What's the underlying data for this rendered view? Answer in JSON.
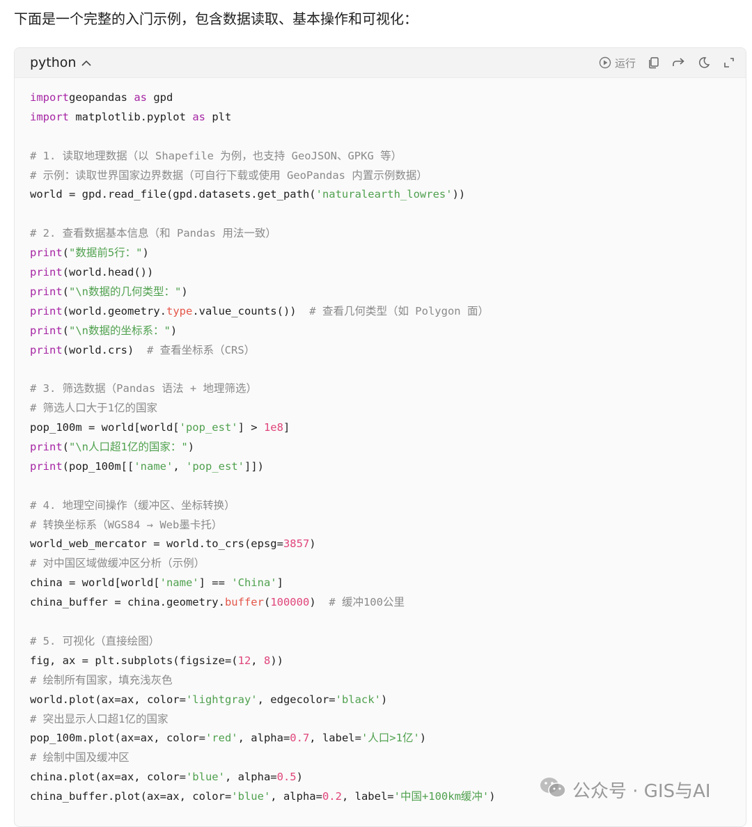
{
  "intro_text": "下面是一个完整的入门示例，包含数据读取、基本操作和可视化：",
  "code_block": {
    "language": "python",
    "run_label": "运行",
    "icons": {
      "collapse": "chevron-up-icon",
      "run": "play-circle-icon",
      "copy": "copy-icon",
      "share": "share-icon",
      "theme": "moon-icon",
      "expand": "expand-icon"
    },
    "lines": [
      [
        [
          "kw",
          "import"
        ],
        [
          "",
          "geopandas "
        ],
        [
          "kw",
          "as"
        ],
        [
          "",
          " gpd"
        ]
      ],
      [
        [
          "kw",
          "import"
        ],
        [
          "",
          " matplotlib.pyplot "
        ],
        [
          "kw",
          "as"
        ],
        [
          "",
          " plt"
        ]
      ],
      [],
      [
        [
          "cm",
          "# 1. 读取地理数据（以 Shapefile 为例，也支持 GeoJSON、GPKG 等）"
        ]
      ],
      [
        [
          "cm",
          "# 示例：读取世界国家边界数据（可自行下载或使用 GeoPandas 内置示例数据）"
        ]
      ],
      [
        [
          "",
          "world = gpd.read_file(gpd.datasets.get_path("
        ],
        [
          "str",
          "'naturalearth_lowres'"
        ],
        [
          "",
          "))"
        ]
      ],
      [],
      [
        [
          "cm",
          "# 2. 查看数据基本信息（和 Pandas 用法一致）"
        ]
      ],
      [
        [
          "fn",
          "print"
        ],
        [
          "",
          "("
        ],
        [
          "str",
          "\"数据前5行：\""
        ],
        [
          "",
          ")"
        ]
      ],
      [
        [
          "fn",
          "print"
        ],
        [
          "",
          "(world.head())"
        ]
      ],
      [
        [
          "fn",
          "print"
        ],
        [
          "",
          "("
        ],
        [
          "str",
          "\"\\n数据的几何类型：\""
        ],
        [
          "",
          ")"
        ]
      ],
      [
        [
          "fn",
          "print"
        ],
        [
          "",
          "(world.geometry."
        ],
        [
          "attr",
          "type"
        ],
        [
          "",
          ".value_counts())  "
        ],
        [
          "cm",
          "# 查看几何类型（如 Polygon 面）"
        ]
      ],
      [
        [
          "fn",
          "print"
        ],
        [
          "",
          "("
        ],
        [
          "str",
          "\"\\n数据的坐标系：\""
        ],
        [
          "",
          ")"
        ]
      ],
      [
        [
          "fn",
          "print"
        ],
        [
          "",
          "(world.crs)  "
        ],
        [
          "cm",
          "# 查看坐标系（CRS）"
        ]
      ],
      [],
      [
        [
          "cm",
          "# 3. 筛选数据（Pandas 语法 + 地理筛选）"
        ]
      ],
      [
        [
          "cm",
          "# 筛选人口大于1亿的国家"
        ]
      ],
      [
        [
          "",
          "pop_100m = world[world["
        ],
        [
          "str",
          "'pop_est'"
        ],
        [
          "",
          "] > "
        ],
        [
          "num",
          "1e8"
        ],
        [
          "",
          "]"
        ]
      ],
      [
        [
          "fn",
          "print"
        ],
        [
          "",
          "("
        ],
        [
          "str",
          "\"\\n人口超1亿的国家：\""
        ],
        [
          "",
          ")"
        ]
      ],
      [
        [
          "fn",
          "print"
        ],
        [
          "",
          "(pop_100m[["
        ],
        [
          "str",
          "'name'"
        ],
        [
          "",
          ", "
        ],
        [
          "str",
          "'pop_est'"
        ],
        [
          "",
          "]])"
        ]
      ],
      [],
      [
        [
          "cm",
          "# 4. 地理空间操作（缓冲区、坐标转换）"
        ]
      ],
      [
        [
          "cm",
          "# 转换坐标系（WGS84 → Web墨卡托）"
        ]
      ],
      [
        [
          "",
          "world_web_mercator = world.to_crs(epsg="
        ],
        [
          "num",
          "3857"
        ],
        [
          "",
          ")"
        ]
      ],
      [
        [
          "cm",
          "# 对中国区域做缓冲区分析（示例）"
        ]
      ],
      [
        [
          "",
          "china = world[world["
        ],
        [
          "str",
          "'name'"
        ],
        [
          "",
          "] == "
        ],
        [
          "str",
          "'China'"
        ],
        [
          "",
          "]"
        ]
      ],
      [
        [
          "",
          "china_buffer = china.geometry."
        ],
        [
          "attr",
          "buffer"
        ],
        [
          "",
          "("
        ],
        [
          "num",
          "100000"
        ],
        [
          "",
          ")  "
        ],
        [
          "cm",
          "# 缓冲100公里"
        ]
      ],
      [],
      [
        [
          "cm",
          "# 5. 可视化（直接绘图）"
        ]
      ],
      [
        [
          "",
          "fig, ax = plt.subplots(figsize=("
        ],
        [
          "num",
          "12"
        ],
        [
          "",
          ", "
        ],
        [
          "num",
          "8"
        ],
        [
          "",
          "))"
        ]
      ],
      [
        [
          "cm",
          "# 绘制所有国家，填充浅灰色"
        ]
      ],
      [
        [
          "",
          "world.plot(ax=ax, color="
        ],
        [
          "str",
          "'lightgray'"
        ],
        [
          "",
          ", edgecolor="
        ],
        [
          "str",
          "'black'"
        ],
        [
          "",
          ")"
        ]
      ],
      [
        [
          "cm",
          "# 突出显示人口超1亿的国家"
        ]
      ],
      [
        [
          "",
          "pop_100m.plot(ax=ax, color="
        ],
        [
          "str",
          "'red'"
        ],
        [
          "",
          ", alpha="
        ],
        [
          "num",
          "0.7"
        ],
        [
          "",
          ", label="
        ],
        [
          "str",
          "'人口>1亿'"
        ],
        [
          "",
          ")"
        ]
      ],
      [
        [
          "cm",
          "# 绘制中国及缓冲区"
        ]
      ],
      [
        [
          "",
          "china.plot(ax=ax, color="
        ],
        [
          "str",
          "'blue'"
        ],
        [
          "",
          ", alpha="
        ],
        [
          "num",
          "0.5"
        ],
        [
          "",
          ")"
        ]
      ],
      [
        [
          "",
          "china_buffer.plot(ax=ax, color="
        ],
        [
          "str",
          "'blue'"
        ],
        [
          "",
          ", alpha="
        ],
        [
          "num",
          "0.2"
        ],
        [
          "",
          ", label="
        ],
        [
          "str",
          "'中国+100km缓冲'"
        ],
        [
          "",
          ")"
        ]
      ]
    ]
  },
  "watermark": {
    "text": "公众号 · GIS与AI",
    "icon": "wechat-icon"
  },
  "colors": {
    "keyword": "#a626a4",
    "string": "#50a14f",
    "number": "#e0457b",
    "comment": "#8a8a8a",
    "attribute": "#e45649"
  }
}
